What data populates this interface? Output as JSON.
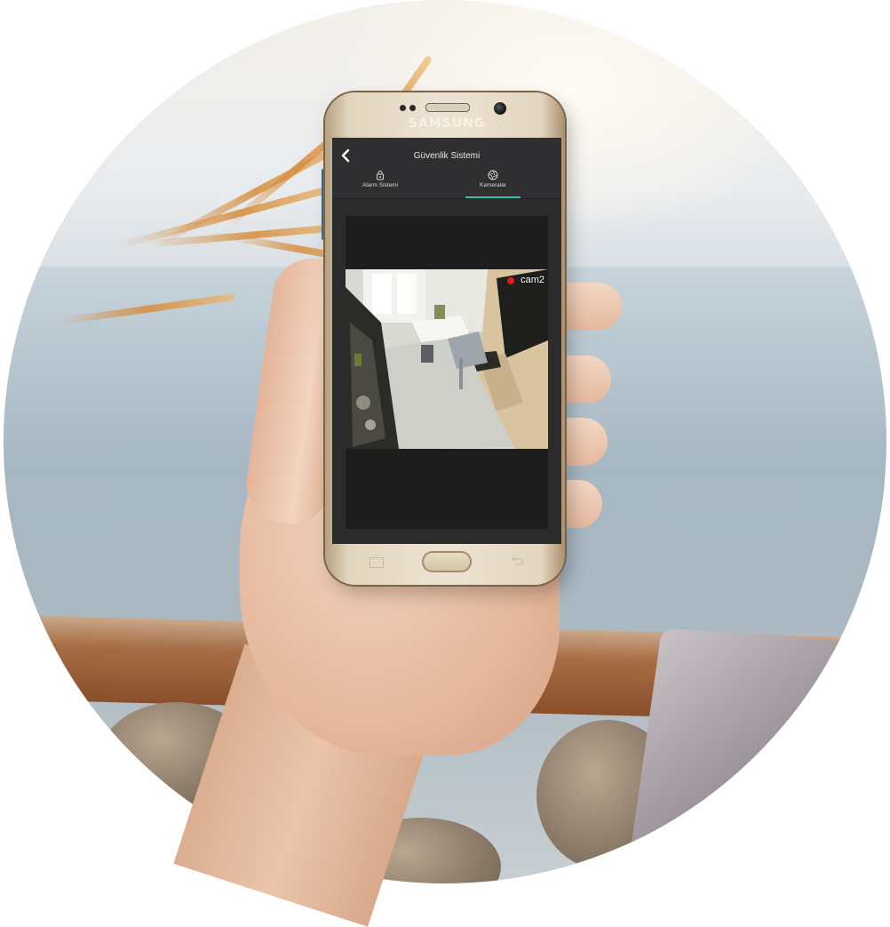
{
  "device": {
    "brand": "SAMSUNG"
  },
  "app": {
    "title": "Güvenlik Sistemi",
    "back_icon": "chevron-left-icon",
    "tabs": [
      {
        "label": "Alarm Sistemi",
        "icon": "lock-icon",
        "active": false
      },
      {
        "label": "Kameralar",
        "icon": "camera-aperture-icon",
        "active": true
      }
    ],
    "accent_color": "#3bbfb0"
  },
  "camera": {
    "name": "cam2",
    "status_color": "#e21a1a"
  }
}
